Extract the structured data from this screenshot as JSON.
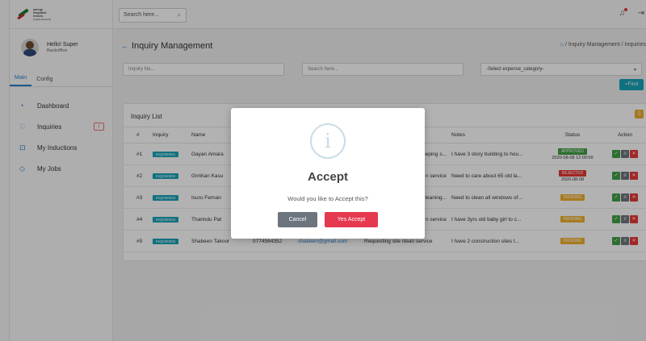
{
  "brand": {
    "line1": "ynergy",
    "line2": "ntegrated",
    "line3": "ervices",
    "line4": "Quality Rewards"
  },
  "user": {
    "greeting": "Hello! Super",
    "role": "Backoffice"
  },
  "sidebar_tabs": [
    {
      "label": "Main",
      "active": true
    },
    {
      "label": "Config",
      "active": false
    }
  ],
  "menu": [
    {
      "label": "Dashboard",
      "icon": "dashboard-icon"
    },
    {
      "label": "Inquiries",
      "icon": "chat-bubble-icon",
      "badge": "1"
    },
    {
      "label": "My Inductions",
      "icon": "lock-icon"
    },
    {
      "label": "My Jobs",
      "icon": "tag-icon"
    }
  ],
  "topbar": {
    "search_placeholder": "Search here..."
  },
  "page": {
    "title": "Inquiry Management",
    "breadcrumb_sep1": "/",
    "breadcrumb_1": "Inquiry Management",
    "breadcrumb_sep2": "/",
    "breadcrumb_2": "Inquiries"
  },
  "filters": {
    "inquiry_no_placeholder": "Inquiry No...",
    "search_placeholder": "Search here...",
    "category_selected": "-Select expense_category-",
    "find_label": "Find"
  },
  "list": {
    "title": "Inquiry List",
    "columns": [
      "#",
      "Inquiry",
      "Name",
      "",
      "",
      "",
      "Notes",
      "Status",
      "Action"
    ],
    "rows": [
      {
        "num": "#1",
        "inquiry": "INQ/000001",
        "name": "Gayan Amara",
        "phone": "",
        "email": "",
        "request": "eeping s...",
        "notes": "I have 3 story building to hou...",
        "status": "APPROVED",
        "status_type": "approved",
        "status_date": "2020-08-08 12:00:00"
      },
      {
        "num": "#2",
        "inquiry": "INQ/000002",
        "name": "Gimhan Kasu",
        "phone": "",
        "email": "",
        "request": "n service",
        "notes": "Need to care about 65 old la...",
        "status": "REJECTED",
        "status_type": "rejected",
        "status_date": "2020-08-08"
      },
      {
        "num": "#3",
        "inquiry": "INQ/000003",
        "name": "Isuru Fernan",
        "phone": "",
        "email": "",
        "request": "leaning...",
        "notes": "Need to clean all windows of...",
        "status": "PENDING",
        "status_type": "pending",
        "status_date": ""
      },
      {
        "num": "#4",
        "inquiry": "INQ/000004",
        "name": "Tharindu Pat",
        "phone": "",
        "email": "",
        "request": "n service",
        "notes": "I have 3yrs old baby girl to c...",
        "status": "PENDING",
        "status_type": "pending",
        "status_date": ""
      },
      {
        "num": "#5",
        "inquiry": "INQ/000005",
        "name": "Shabeen Takoor",
        "phone": "0774564352",
        "email": "shabeen@gmail.com",
        "request": "Requesting site clean service",
        "notes": "I have 2 construction sites t...",
        "status": "PENDING",
        "status_type": "pending",
        "status_date": ""
      }
    ]
  },
  "modal": {
    "icon": "info-icon",
    "icon_glyph": "i",
    "title": "Accept",
    "message": "Would you like to Accept this?",
    "cancel_label": "Cancel",
    "confirm_label": "Yes Accept"
  },
  "colors": {
    "accent": "#2a7fd0",
    "teal": "#17a2b8",
    "confirm": "#e53950",
    "cancel": "#6c757d"
  }
}
